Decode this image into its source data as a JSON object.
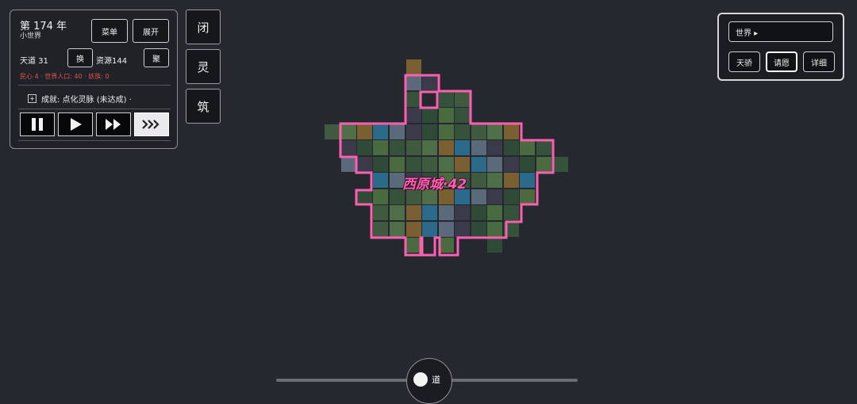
{
  "status_panel": {
    "year": "第 174 年",
    "world_type": "小世界",
    "menu_label": "菜单",
    "expand_label": "展开",
    "tiandao": "天道 31",
    "swap_label": "换",
    "resources": "资源144",
    "gather_label": "聚",
    "warnings": "民心 4 · 世界人口: 40 · 妖族: 0",
    "achievement": "成就: 点化灵脉 (未达成) ·",
    "achievement_icon": "plus-square-icon",
    "speed_buttons": [
      {
        "icon": "pause-icon"
      },
      {
        "icon": "play-icon"
      },
      {
        "icon": "fast-forward-icon"
      },
      {
        "icon": "fastest-icon",
        "active": true
      }
    ]
  },
  "side_buttons": [
    "闭",
    "灵",
    "筑"
  ],
  "world_panel": {
    "selector": "世界 ▸",
    "buttons": [
      "天骄",
      "请愿",
      "详细"
    ]
  },
  "map": {
    "city_label": "西原城·42",
    "border_color": "#ff5fb0",
    "tile_colors": [
      "#3f5a3e",
      "#35523a",
      "#4a6a40",
      "#2f4a36",
      "#3a3a4a",
      "#5a6a7a",
      "#2b6a8a",
      "#7a6030",
      "#4e6e48"
    ]
  },
  "bottom": {
    "dao_label": "道"
  }
}
